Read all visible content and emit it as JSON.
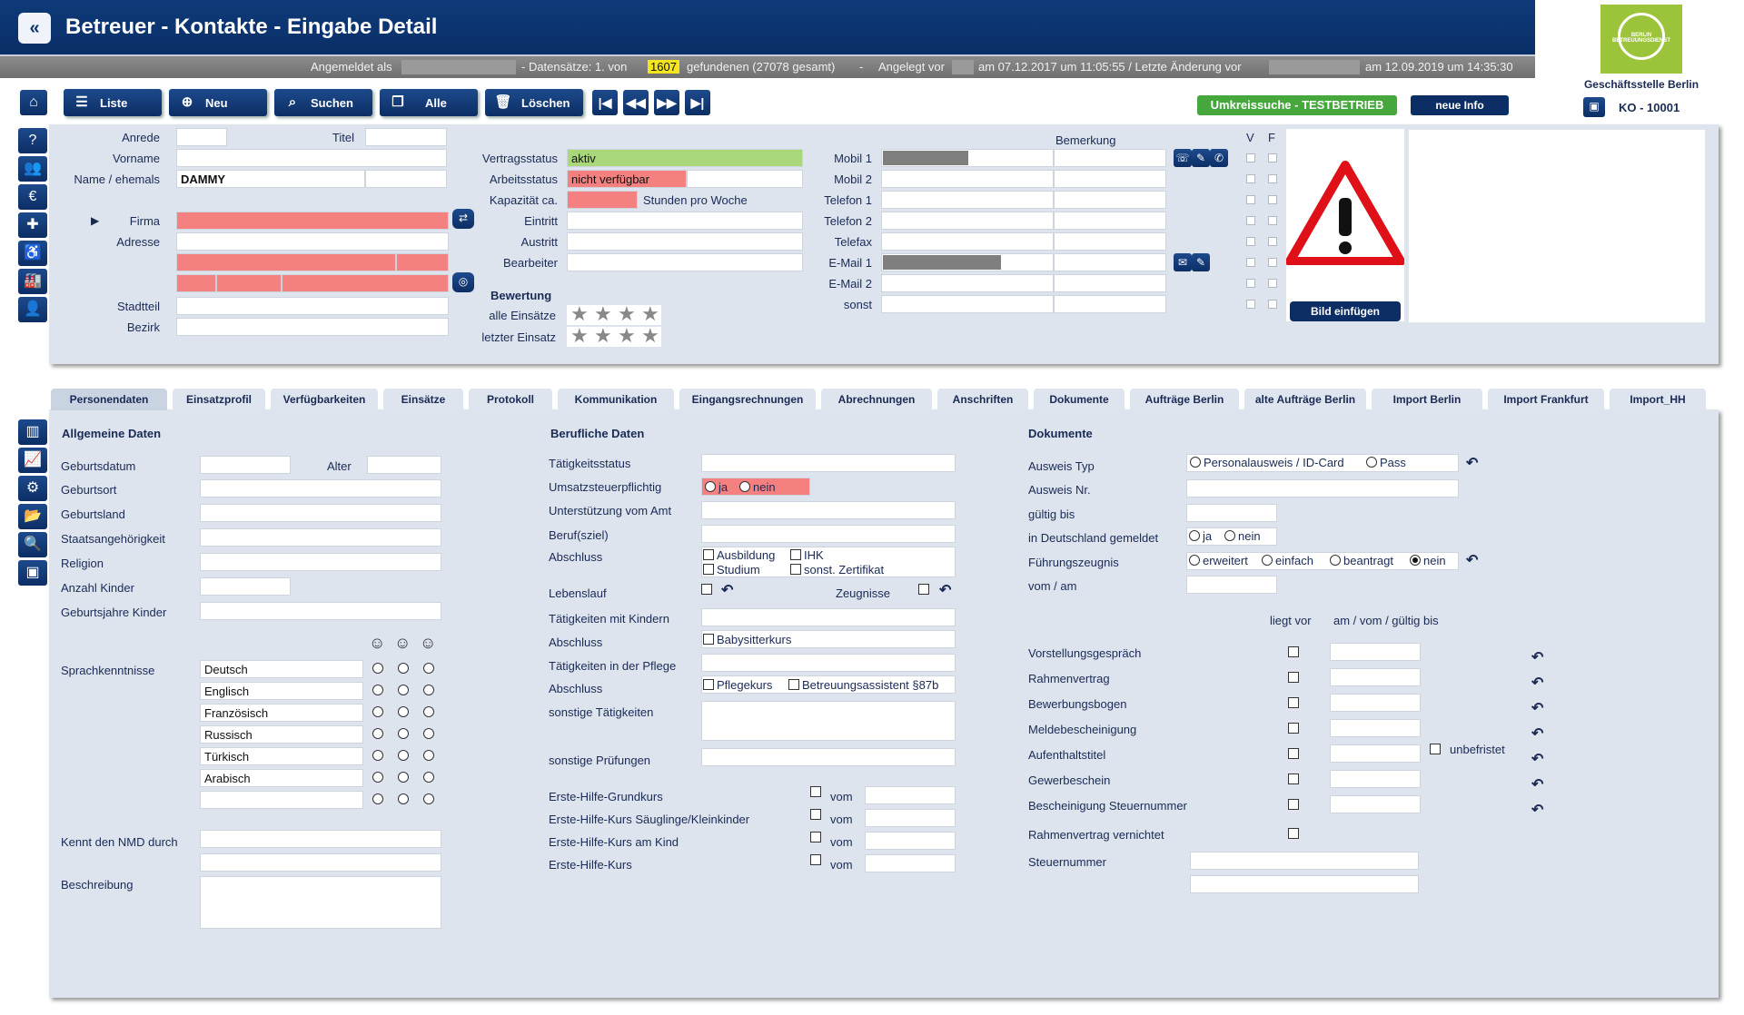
{
  "window": {
    "title": "Betreuer - Kontakte - Eingabe Detail",
    "back_icon": "double-chevron-left-icon"
  },
  "infobar": {
    "logged_in_label": "Angemeldet als",
    "records_label": "-  Datensätze: 1. von",
    "records_found": "1607",
    "records_suffix": "gefundenen (27078 gesamt)",
    "sep": "-",
    "created_label": "Angelegt vor",
    "created_value": "am 07.12.2017 um 11:05:55  /  Letzte Änderung vor",
    "changed_value": "am 12.09.2019 um 14:35:30"
  },
  "org": {
    "name": "Geschäftsstelle Berlin",
    "id": "KO -  10001",
    "logo_text": "BERLIN BETREUUNGSDIENST"
  },
  "toolbar": {
    "liste": "Liste",
    "neu": "Neu",
    "suchen": "Suchen",
    "alle": "Alle",
    "loeschen": "Löschen"
  },
  "top_buttons": {
    "umkreissuche": "Umkreissuche - TESTBETRIEB",
    "neue_info": "neue Info",
    "bild_einfuegen": "Bild einfügen"
  },
  "person": {
    "anrede_label": "Anrede",
    "titel_label": "Titel",
    "vorname_label": "Vorname",
    "name_label": "Name / ehemals",
    "name_value": "DAMMY",
    "firma_label": "Firma",
    "adresse_label": "Adresse",
    "stadtteil_label": "Stadtteil",
    "bezirk_label": "Bezirk"
  },
  "contract": {
    "vertragsstatus_label": "Vertragsstatus",
    "vertragsstatus_value": "aktiv",
    "arbeitsstatus_label": "Arbeitsstatus",
    "arbeitsstatus_value": "nicht verfügbar",
    "kapazitaet_label": "Kapazität ca.",
    "kapazitaet_unit": "Stunden pro Woche",
    "eintritt_label": "Eintritt",
    "austritt_label": "Austritt",
    "bearbeiter_label": "Bearbeiter",
    "bewertung_label": "Bewertung",
    "alle_einsaetze_label": "alle Einsätze",
    "letzter_einsatz_label": "letzter Einsatz",
    "rating_all": 0,
    "rating_last": 0
  },
  "contact": {
    "bemerkung_label": "Bemerkung",
    "v_label": "V",
    "f_label": "F",
    "rows": [
      "Mobil 1",
      "Mobil 2",
      "Telefon 1",
      "Telefon 2",
      "Telefax",
      "E-Mail 1",
      "E-Mail 2",
      "sonst"
    ]
  },
  "tabs": [
    "Personendaten",
    "Einsatzprofil",
    "Verfügbarkeiten",
    "Einsätze",
    "Protokoll",
    "Kommunikation",
    "Eingangsrechnungen",
    "Abrechnungen",
    "Anschriften",
    "Dokumente",
    "Aufträge Berlin",
    "alte Aufträge Berlin",
    "Import Berlin",
    "Import Frankfurt",
    "Import_HH"
  ],
  "allgemein": {
    "title": "Allgemeine Daten",
    "geburtsdatum": "Geburtsdatum",
    "alter": "Alter",
    "geburtsort": "Geburtsort",
    "geburtsland": "Geburtsland",
    "staatsangehoerigkeit": "Staatsangehörigkeit",
    "religion": "Religion",
    "anzahl_kinder": "Anzahl Kinder",
    "geburtsjahre_kinder": "Geburtsjahre  Kinder",
    "sprachkenntnisse": "Sprachkenntnisse",
    "languages": [
      "Deutsch",
      "Englisch",
      "Französisch",
      "Russisch",
      "Türkisch",
      "Arabisch",
      ""
    ],
    "kennt_nmd": "Kennt den NMD durch",
    "beschreibung": "Beschreibung"
  },
  "beruflich": {
    "title": "Berufliche Daten",
    "taetigkeitsstatus": "Tätigkeitsstatus",
    "umsatzsteuer": "Umsatzsteuerpflichtig",
    "ja": "ja",
    "nein": "nein",
    "unterstuetzung": "Unterstützung vom Amt",
    "berufsziel": "Beruf(sziel)",
    "abschluss": "Abschluss",
    "ausbildung": "Ausbildung",
    "ihk": "IHK",
    "studium": "Studium",
    "sonst_zertifikat": "sonst. Zertifikat",
    "lebenslauf": "Lebenslauf",
    "zeugnisse": "Zeugnisse",
    "taetigkeiten_kindern": "Tätigkeiten mit Kindern",
    "babysitterkurs": "Babysitterkurs",
    "taetigkeiten_pflege": "Tätigkeiten in der Pflege",
    "pflegekurs": "Pflegekurs",
    "betreuungsassistent": "Betreuungsassistent §87b",
    "sonstige_taetigkeiten": "sonstige Tätigkeiten",
    "sonstige_pruefungen": "sonstige Prüfungen",
    "erste_hilfe": [
      "Erste-Hilfe-Grundkurs",
      "Erste-Hilfe-Kurs Säuglinge/Kleinkinder",
      "Erste-Hilfe-Kurs am  Kind",
      "Erste-Hilfe-Kurs"
    ],
    "vom": "vom"
  },
  "dokumente": {
    "title": "Dokumente",
    "ausweis_typ": "Ausweis Typ",
    "personalausweis": "Personalausweis / ID-Card",
    "pass": "Pass",
    "ausweis_nr": "Ausweis Nr.",
    "gueltig_bis": "gültig bis",
    "in_deutschland": "in Deutschland gemeldet",
    "ja": "ja",
    "nein": "nein",
    "fuehrungszeugnis": "Führungszeugnis",
    "fz_options": [
      "erweitert",
      "einfach",
      "beantragt",
      "nein"
    ],
    "fz_selected": "nein",
    "vom_am": "vom / am",
    "liegt_vor": "liegt vor",
    "am_header": "am / vom / gültig bis",
    "items": [
      "Vorstellungsgespräch",
      "Rahmenvertrag",
      "Bewerbungsbogen",
      "Meldebescheinigung",
      "Aufenthaltstitel",
      "Gewerbeschein",
      "Bescheinigung Steuernummer",
      "Rahmenvertrag vernichtet"
    ],
    "unbefristet": "unbefristet",
    "steuernummer": "Steuernummer"
  }
}
